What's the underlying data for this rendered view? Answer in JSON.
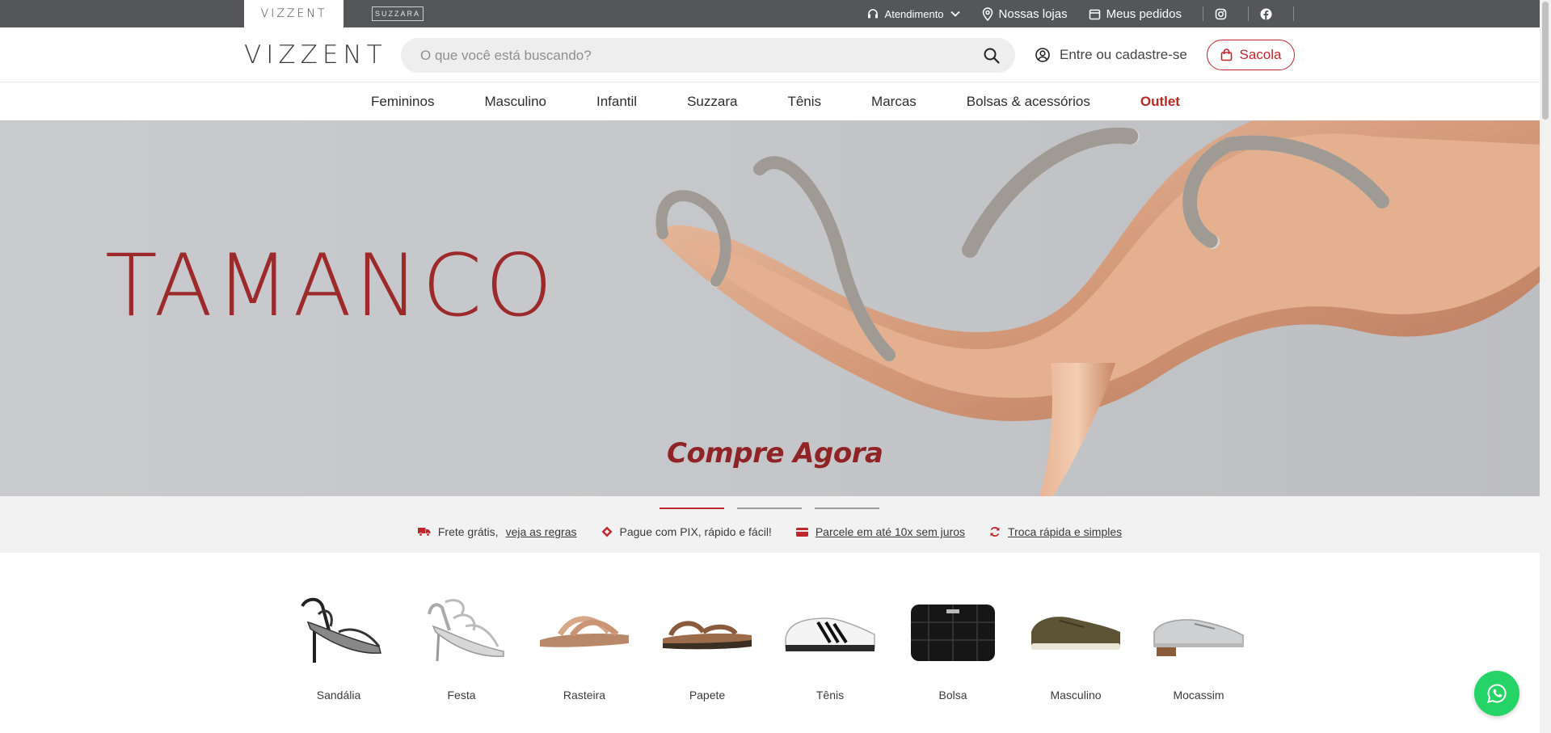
{
  "topbar": {
    "brands": [
      {
        "label": "VIZZENT",
        "active": true
      },
      {
        "label": "SUZZARA",
        "active": false
      }
    ],
    "links": {
      "atendimento": "Atendimento",
      "lojas": "Nossas lojas",
      "pedidos": "Meus pedidos"
    },
    "icons": [
      "headset-icon",
      "chevron-down-icon",
      "map-pin-icon",
      "calendar-icon",
      "instagram-icon",
      "facebook-icon"
    ]
  },
  "header": {
    "logo": "VIZZENT",
    "search_placeholder": "O que você está buscando?",
    "search_value": "",
    "account_label": "Entre ou cadastre-se",
    "bag_label": "Sacola"
  },
  "nav": {
    "items": [
      "Femininos",
      "Masculino",
      "Infantil",
      "Suzzara",
      "Tênis",
      "Marcas",
      "Bolsas & acessórios",
      "Outlet"
    ]
  },
  "hero": {
    "title": "TAMANCO",
    "cta": "Compre Agora",
    "slides": 3,
    "active_slide": 1
  },
  "benefits": {
    "frete_text": "Frete grátis,",
    "frete_link": "veja as regras",
    "pix": "Pague com PIX, rápido e fácil!",
    "parcele": "Parcele em até 10x sem juros",
    "troca": "Troca rápida e simples"
  },
  "categories": [
    "Sandália",
    "Festa",
    "Rasteira",
    "Papete",
    "Tênis",
    "Bolsa",
    "Masculino",
    "Mocassim"
  ],
  "colors": {
    "brand_red": "#c0272d",
    "topbar": "#555659",
    "whatsapp": "#25d366"
  }
}
